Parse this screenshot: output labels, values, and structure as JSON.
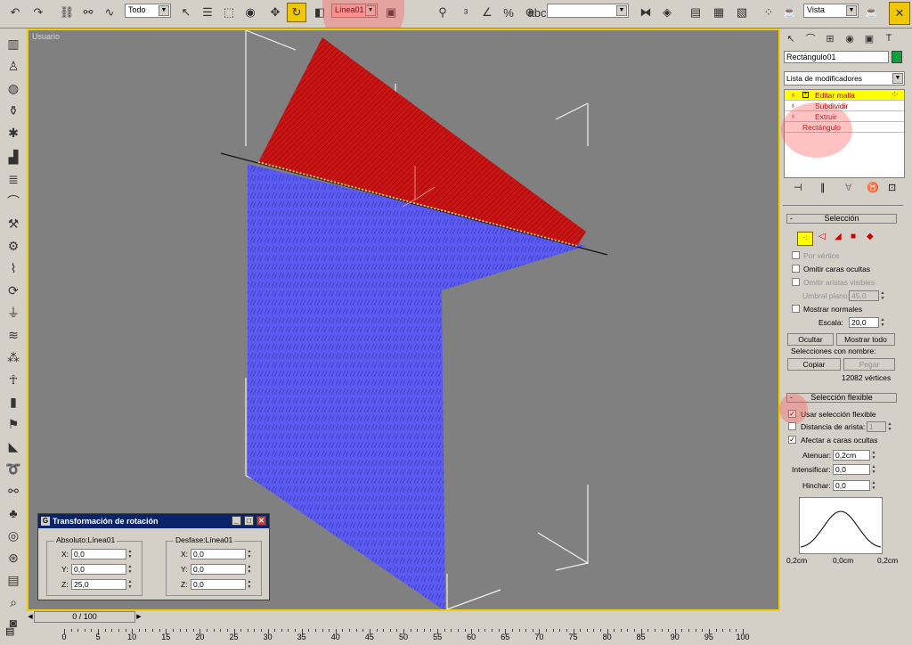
{
  "toolbar": {
    "selection_filter": "Todo",
    "named_selection": "Línea01",
    "named_set_field": "",
    "coord_system": "Vista"
  },
  "viewport": {
    "label": "Usuario"
  },
  "panel": {
    "object_name": "Rectángulo01",
    "modifier_list_label": "Lista de modificadores",
    "modifier_stack": [
      "Editar malla",
      "Subdividir",
      "Extruir",
      "Rectángulo"
    ],
    "selection": {
      "title": "Selección",
      "por_vertice": "Por vértice",
      "omitir_caras": "Omitir caras ocultas",
      "omitir_aristas": "Omitir aristas visibles",
      "umbral_label": "Umbral plano:",
      "umbral_value": "45,0",
      "mostrar_normales": "Mostrar normales",
      "escala_label": "Escala:",
      "escala_value": "20,0",
      "ocultar": "Ocultar",
      "mostrar_todo": "Mostrar todo",
      "selecciones_label": "Selecciones con nombre:",
      "copiar": "Copiar",
      "pegar": "Pegar",
      "vertices_count": "12082 vértices"
    },
    "soft_selection": {
      "title": "Selección flexible",
      "usar": "Usar selección flexible",
      "usar_checked": true,
      "distancia_label": "Distancia de arista:",
      "distancia_value": "1",
      "afectar": "Afectar a caras ocultas",
      "afectar_checked": true,
      "atenuar_label": "Atenuar:",
      "atenuar_value": "0,2cm",
      "intensificar_label": "Intensificar:",
      "intensificar_value": "0,0",
      "hinchar_label": "Hinchar:",
      "hinchar_value": "0,0",
      "curve_left": "0,2cm",
      "curve_mid": "0,0cm",
      "curve_right": "0,2cm"
    }
  },
  "dialog": {
    "title": "Transformación de rotación",
    "absolute_group": "Absoluto:Línea01",
    "offset_group": "Desfase:Línea01",
    "abs_x": "0,0",
    "abs_y": "0,0",
    "abs_z": "25,0",
    "off_x": "0,0",
    "off_y": "0,0",
    "off_z": "0,0",
    "x_label": "X:",
    "y_label": "Y:",
    "z_label": "Z:"
  },
  "timeline": {
    "frame": "0 / 100",
    "ticks": [
      "0",
      "5",
      "10",
      "15",
      "20",
      "25",
      "30",
      "35",
      "40",
      "45",
      "50",
      "55",
      "60",
      "65",
      "70",
      "75",
      "80",
      "85",
      "90",
      "95",
      "100"
    ]
  },
  "colors": {
    "accent_yellow": "#f0d000",
    "red_face": "#c81414",
    "blue_face": "#5050f0",
    "title_bar": "#0a246a"
  }
}
